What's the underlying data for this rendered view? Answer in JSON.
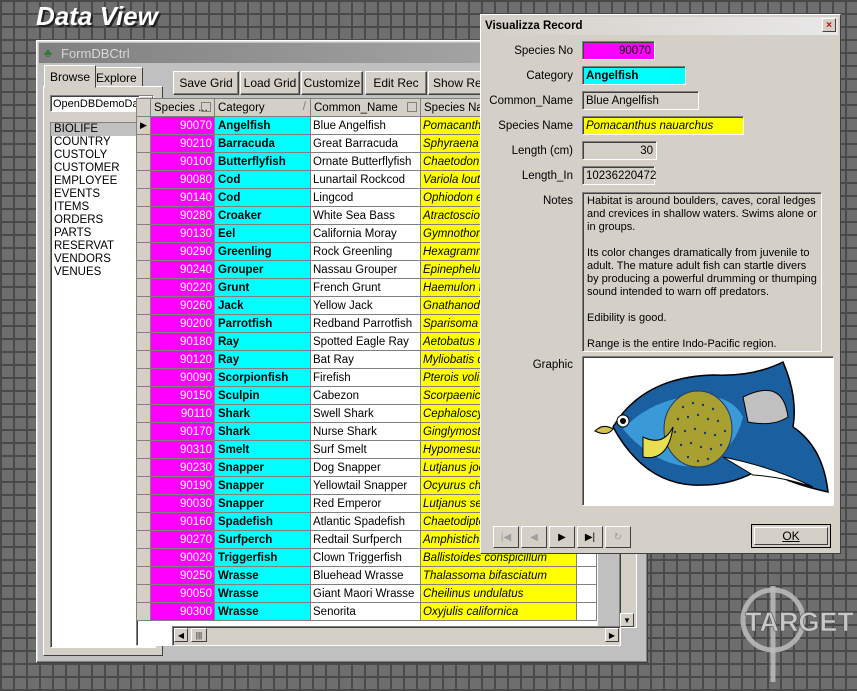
{
  "banner": {
    "title": "Data View"
  },
  "form": {
    "title": "FormDBCtrl",
    "tabs": [
      "Browse",
      "Explore"
    ],
    "database": "OpenDBDemoDa",
    "tables": [
      "BIOLIFE",
      "COUNTRY",
      "CUSTOLY",
      "CUSTOMER",
      "EMPLOYEE",
      "EVENTS",
      "ITEMS",
      "ORDERS",
      "PARTS",
      "RESERVAT",
      "VENDORS",
      "VENUES"
    ],
    "selected_table": "BIOLIFE",
    "toolbar": [
      "Save Grid",
      "Load Grid",
      "Customize",
      "Edit Rec",
      "Show Rec"
    ]
  },
  "grid": {
    "columns": [
      "Species ...",
      "Category",
      "Common_Name",
      "Species Name"
    ],
    "rows": [
      [
        "90070",
        "Angelfish",
        "Blue Angelfish",
        "Pomacanthus nauarchus"
      ],
      [
        "90210",
        "Barracuda",
        "Great Barracuda",
        "Sphyraena barracuda"
      ],
      [
        "90100",
        "Butterflyfish",
        "Ornate Butterflyfish",
        "Chaetodon ornatissimus"
      ],
      [
        "90080",
        "Cod",
        "Lunartail Rockcod",
        "Variola louti"
      ],
      [
        "90140",
        "Cod",
        "Lingcod",
        "Ophiodon elongatus"
      ],
      [
        "90280",
        "Croaker",
        "White Sea Bass",
        "Atractoscion nobilis"
      ],
      [
        "90130",
        "Eel",
        "California Moray",
        "Gymnothorax mordax"
      ],
      [
        "90290",
        "Greenling",
        "Rock Greenling",
        "Hexagrammos lagocephalus"
      ],
      [
        "90240",
        "Grouper",
        "Nassau Grouper",
        "Epinephelus striatus"
      ],
      [
        "90220",
        "Grunt",
        "French Grunt",
        "Haemulon flavolineatum"
      ],
      [
        "90260",
        "Jack",
        "Yellow Jack",
        "Gnathanodon speciosus"
      ],
      [
        "90200",
        "Parrotfish",
        "Redband Parrotfish",
        "Sparisoma aurofrenatum"
      ],
      [
        "90180",
        "Ray",
        "Spotted Eagle Ray",
        "Aetobatus narinari"
      ],
      [
        "90120",
        "Ray",
        "Bat Ray",
        "Myliobatis californica"
      ],
      [
        "90090",
        "Scorpionfish",
        "Firefish",
        "Pterois volitans"
      ],
      [
        "90150",
        "Sculpin",
        "Cabezon",
        "Scorpaenichthys marmoratus"
      ],
      [
        "90110",
        "Shark",
        "Swell Shark",
        "Cephaloscyllium ventriosum"
      ],
      [
        "90170",
        "Shark",
        "Nurse Shark",
        "Ginglymostoma cirratum"
      ],
      [
        "90310",
        "Smelt",
        "Surf Smelt",
        "Hypomesus pretiosus"
      ],
      [
        "90230",
        "Snapper",
        "Dog Snapper",
        "Lutjanus jocu"
      ],
      [
        "90190",
        "Snapper",
        "Yellowtail Snapper",
        "Ocyurus chrysurus"
      ],
      [
        "90030",
        "Snapper",
        "Red Emperor",
        "Lutjanus sebae"
      ],
      [
        "90160",
        "Spadefish",
        "Atlantic Spadefish",
        "Chaetodipterus faber"
      ],
      [
        "90270",
        "Surfperch",
        "Redtail Surfperch",
        "Amphistichus rhodoterus"
      ],
      [
        "90020",
        "Triggerfish",
        "Clown Triggerfish",
        "Ballistoides conspicillum"
      ],
      [
        "90250",
        "Wrasse",
        "Bluehead Wrasse",
        "Thalassoma bifasciatum"
      ],
      [
        "90050",
        "Wrasse",
        "Giant Maori Wrasse",
        "Cheilinus undulatus"
      ],
      [
        "90300",
        "Wrasse",
        "Senorita",
        "Oxyjulis californica"
      ]
    ]
  },
  "record": {
    "title": "Visualizza Record",
    "labels": {
      "species_no": "Species No",
      "category": "Category",
      "common_name": "Common_Name",
      "species_name": "Species Name",
      "length_cm": "Length (cm)",
      "length_in": "Length_In",
      "notes": "Notes",
      "graphic": "Graphic"
    },
    "values": {
      "species_no": "90070",
      "category": "Angelfish",
      "common_name": "Blue Angelfish",
      "species_name": "Pomacanthus nauarchus",
      "length_cm": "30",
      "length_in": "10236220472"
    },
    "notes": [
      "Habitat is around boulders, caves, coral ledges and crevices in shallow waters.  Swims alone or in groups.",
      "Its color changes dramatically from juvenile to adult.  The mature adult fish can startle divers by producing a powerful drumming or thumping sound intended to warn off predators.",
      "Edibility is good.",
      "Range is the entire Indo-Pacific region."
    ],
    "ok_label": "OK"
  },
  "logo": {
    "text": "TARGET"
  },
  "colors": {
    "species_no_bg": "#ff00ff",
    "category_bg": "#00ffff",
    "species_name_bg": "#ffff00"
  }
}
